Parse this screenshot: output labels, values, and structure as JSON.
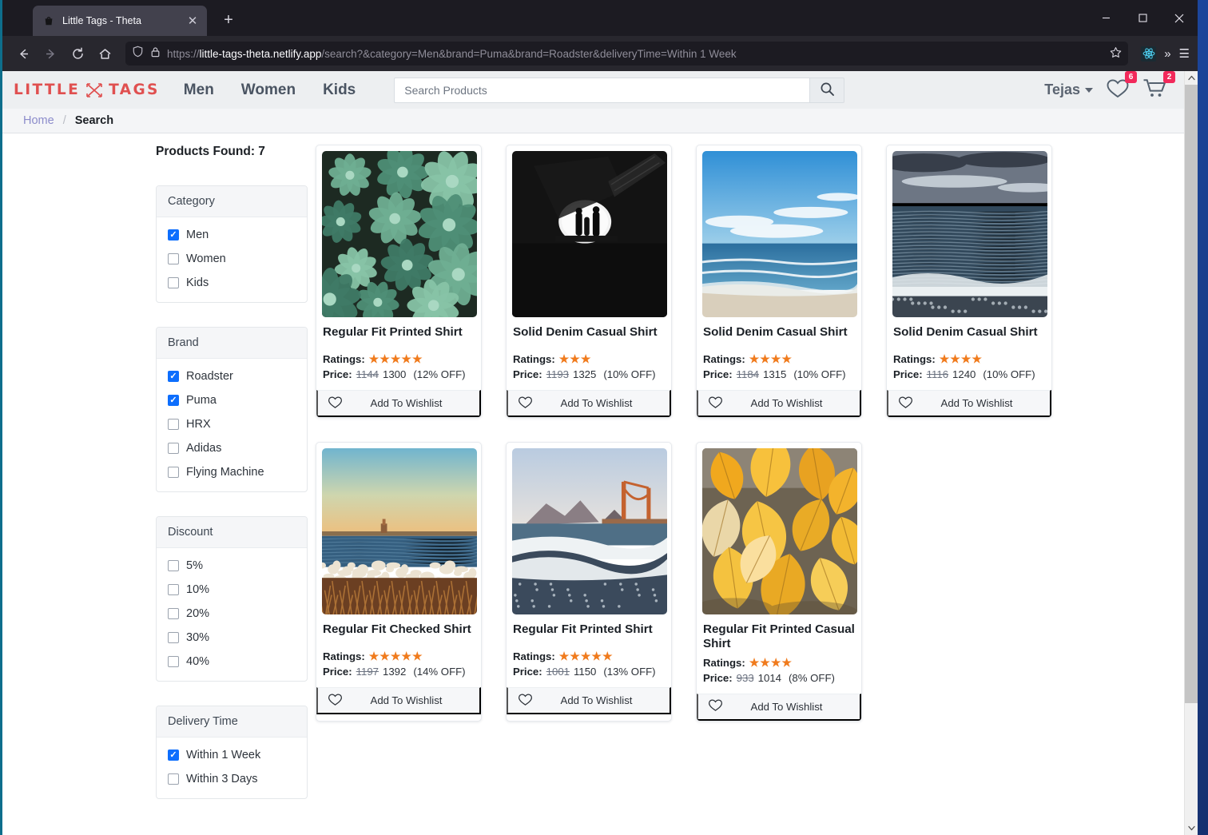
{
  "browser": {
    "tab_title": "Little Tags - Theta",
    "tab_close": "✕",
    "new_tab": "+",
    "url_protocol": "https://",
    "url_host": "little-tags-theta.netlify.app",
    "url_path": "/search?&category=Men&brand=Puma&brand=Roadster&deliveryTime=Within 1 Week",
    "win_minimize": "—",
    "win_maximize": "▢",
    "win_close": "✕",
    "overflow": "»",
    "menu": "☰"
  },
  "header": {
    "logo_left": "LITTLE",
    "logo_right": "TAGS",
    "nav": [
      {
        "label": "Men"
      },
      {
        "label": "Women"
      },
      {
        "label": "Kids"
      }
    ],
    "search_placeholder": "Search Products",
    "search_value": "",
    "user_name": "Tejas",
    "wishlist_count": "6",
    "cart_count": "2"
  },
  "breadcrumb": {
    "home": "Home",
    "separator": "/",
    "current": "Search"
  },
  "sidebar": {
    "products_found": "Products Found: 7",
    "groups": [
      {
        "title": "Category",
        "options": [
          {
            "label": "Men",
            "checked": true
          },
          {
            "label": "Women",
            "checked": false
          },
          {
            "label": "Kids",
            "checked": false
          }
        ]
      },
      {
        "title": "Brand",
        "options": [
          {
            "label": "Roadster",
            "checked": true
          },
          {
            "label": "Puma",
            "checked": true
          },
          {
            "label": "HRX",
            "checked": false
          },
          {
            "label": "Adidas",
            "checked": false
          },
          {
            "label": "Flying Machine",
            "checked": false
          }
        ]
      },
      {
        "title": "Discount",
        "options": [
          {
            "label": "5%",
            "checked": false
          },
          {
            "label": "10%",
            "checked": false
          },
          {
            "label": "20%",
            "checked": false
          },
          {
            "label": "30%",
            "checked": false
          },
          {
            "label": "40%",
            "checked": false
          }
        ]
      },
      {
        "title": "Delivery Time",
        "options": [
          {
            "label": "Within 1 Week",
            "checked": true
          },
          {
            "label": "Within 3 Days",
            "checked": false
          }
        ]
      }
    ]
  },
  "product_labels": {
    "ratings": "Ratings:",
    "price": "Price:",
    "wishlist": "Add To Wishlist"
  },
  "products": [
    {
      "title": "Regular Fit Printed Shirt",
      "stars": "★★★★★",
      "rating": 5,
      "old_price": "1144",
      "price": "1300",
      "discount": "(12% OFF)",
      "image": "succulents"
    },
    {
      "title": "Solid Denim Casual Shirt",
      "stars": "★★★",
      "rating": 3,
      "old_price": "1193",
      "price": "1325",
      "discount": "(10% OFF)",
      "image": "tunnel"
    },
    {
      "title": "Solid Denim Casual Shirt",
      "stars": "★★★★",
      "rating": 4,
      "old_price": "1184",
      "price": "1315",
      "discount": "(10% OFF)",
      "image": "blue-beach"
    },
    {
      "title": "Solid Denim Casual Shirt",
      "stars": "★★★★",
      "rating": 4,
      "old_price": "1116",
      "price": "1240",
      "discount": "(10% OFF)",
      "image": "dark-sea"
    },
    {
      "title": "Regular Fit Checked Shirt",
      "stars": "★★★★★",
      "rating": 5,
      "old_price": "1197",
      "price": "1392",
      "discount": "(14% OFF)",
      "image": "golden-shore"
    },
    {
      "title": "Regular Fit Printed Shirt",
      "stars": "★★★★★",
      "rating": 5,
      "old_price": "1001",
      "price": "1150",
      "discount": "(13% OFF)",
      "image": "bridge-beach"
    },
    {
      "title": "Regular Fit Printed Casual Shirt",
      "stars": "★★★★",
      "rating": 4,
      "old_price": "933",
      "price": "1014",
      "discount": "(8% OFF)",
      "image": "autumn-leaves"
    }
  ],
  "colors": {
    "logo_red": "#e05050",
    "badge_pink": "#f2295b",
    "checkbox_blue": "#0d6efd",
    "star_orange": "#f07b1d",
    "crumb_link": "#8c8ccb"
  }
}
